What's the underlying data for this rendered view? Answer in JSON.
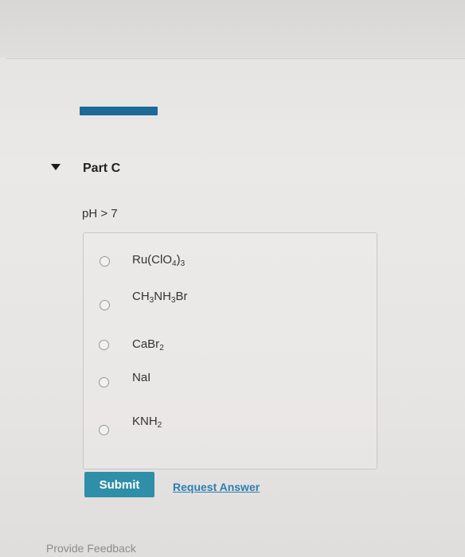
{
  "part": {
    "title": "Part C"
  },
  "question": {
    "text": "pH > 7"
  },
  "options": [
    {
      "base": "Ru(ClO",
      "sub1": "4",
      "mid": ")",
      "sub2": "3",
      "tail": ""
    },
    {
      "base": "CH",
      "sub1": "3",
      "mid": "NH",
      "sub2": "3",
      "tail": "Br"
    },
    {
      "base": "CaBr",
      "sub1": "2",
      "mid": "",
      "sub2": "",
      "tail": ""
    },
    {
      "base": "NaI",
      "sub1": "",
      "mid": "",
      "sub2": "",
      "tail": ""
    },
    {
      "base": "KNH",
      "sub1": "2",
      "mid": "",
      "sub2": "",
      "tail": ""
    }
  ],
  "actions": {
    "submit_label": "Submit",
    "request_answer_label": "Request Answer"
  },
  "footer": {
    "feedback_label": "Provide Feedback"
  },
  "colors": {
    "accent": "#1d6a99",
    "submit": "#2f8ea8",
    "link": "#2c7fb0"
  }
}
